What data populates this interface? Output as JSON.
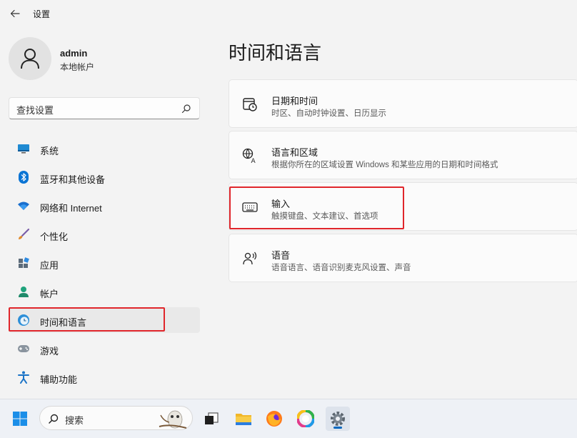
{
  "window": {
    "title": "设置"
  },
  "profile": {
    "name": "admin",
    "account_type": "本地帐户"
  },
  "search": {
    "placeholder": "查找设置"
  },
  "sidebar": {
    "items": [
      {
        "label": "系统",
        "icon": "monitor-icon"
      },
      {
        "label": "蓝牙和其他设备",
        "icon": "bluetooth-icon"
      },
      {
        "label": "网络和 Internet",
        "icon": "wifi-icon"
      },
      {
        "label": "个性化",
        "icon": "brush-icon"
      },
      {
        "label": "应用",
        "icon": "apps-icon"
      },
      {
        "label": "帐户",
        "icon": "person-icon"
      },
      {
        "label": "时间和语言",
        "icon": "globe-clock-icon",
        "selected": true
      },
      {
        "label": "游戏",
        "icon": "gamepad-icon"
      },
      {
        "label": "辅助功能",
        "icon": "accessibility-icon"
      }
    ]
  },
  "main": {
    "title": "时间和语言",
    "cards": [
      {
        "title": "日期和时间",
        "subtitle": "时区、自动时钟设置、日历显示",
        "icon": "calendar-clock-icon"
      },
      {
        "title": "语言和区域",
        "subtitle": "根据你所在的区域设置 Windows 和某些应用的日期和时间格式",
        "icon": "language-icon"
      },
      {
        "title": "输入",
        "subtitle": "触摸键盘、文本建议、首选项",
        "icon": "keyboard-icon"
      },
      {
        "title": "语音",
        "subtitle": "语音语言、语音识别麦克风设置、声音",
        "icon": "speech-icon"
      }
    ]
  },
  "taskbar": {
    "search_label": "搜索",
    "apps": [
      "start-icon",
      "search-icon",
      "task-view-icon",
      "file-explorer-icon",
      "firefox-icon",
      "color-app-icon",
      "settings-icon"
    ]
  },
  "colors": {
    "accent": "#0067c0",
    "highlight": "#e0262b"
  }
}
